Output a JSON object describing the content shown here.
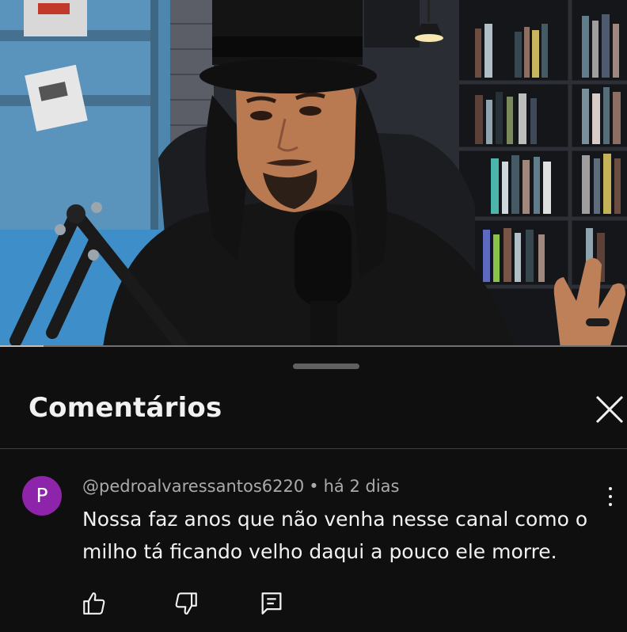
{
  "video": {
    "progress_fraction": 0.07
  },
  "comments_panel": {
    "title": "Comentários",
    "close_icon": "close-icon"
  },
  "comment": {
    "avatar_letter": "P",
    "avatar_color": "#8e24aa",
    "author": "@pedroalvaressantos6220",
    "separator": "•",
    "time": "há 2 dias",
    "text": "Nossa faz anos que não venha nesse canal como o milho tá ficando velho daqui a pouco ele morre.",
    "more_icon": "more-vert-icon",
    "actions": [
      "thumb-up-icon",
      "thumb-down-icon",
      "reply-icon"
    ]
  }
}
